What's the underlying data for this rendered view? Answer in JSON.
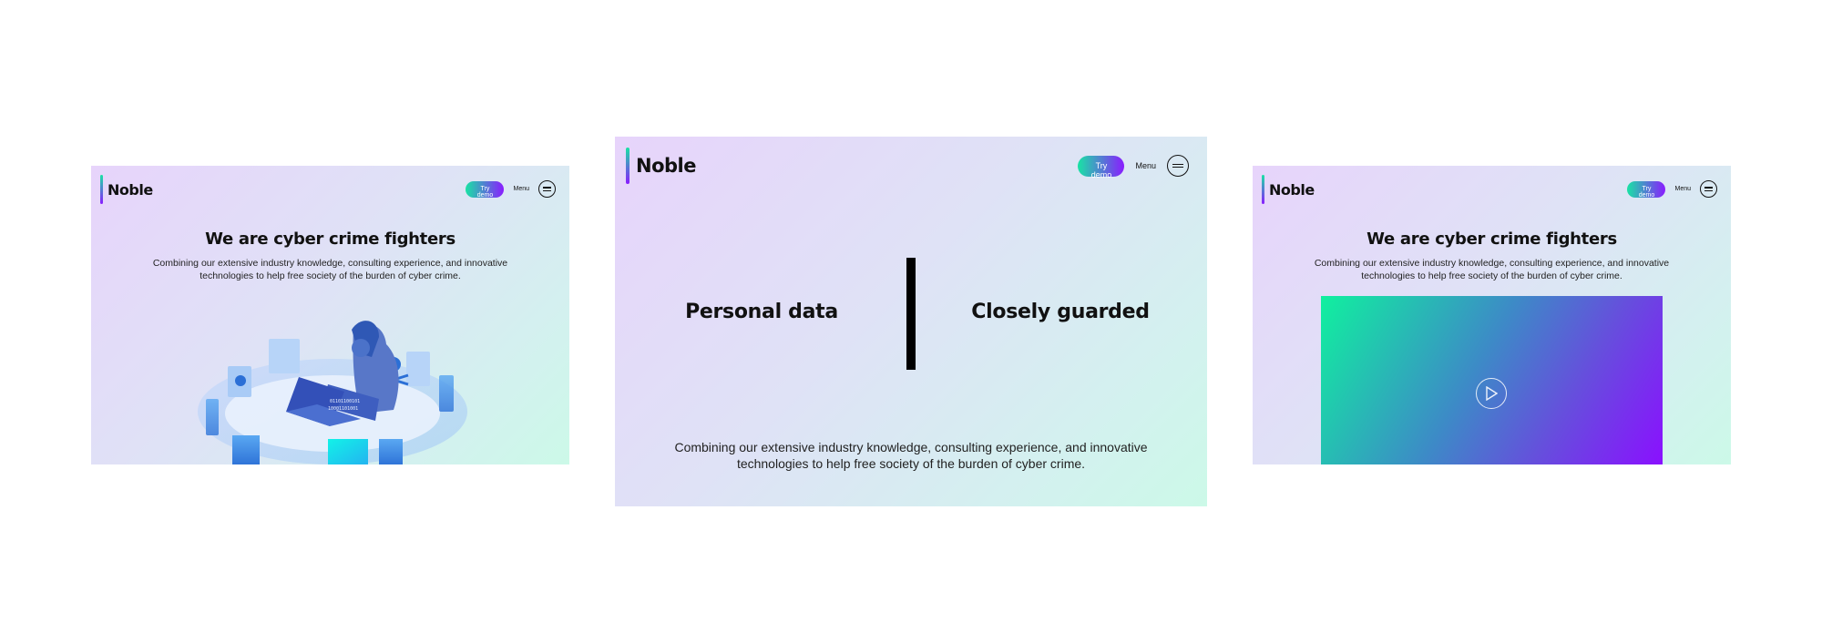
{
  "screens": [
    {
      "logo": "Noble",
      "nav": {
        "demo_label": "Try demo",
        "menu_label": "Menu"
      },
      "title": "We are cyber crime fighters",
      "subtitle": "Combining our extensive industry knowledge, consulting experience, and innovative technologies to help free society of the burden of cyber crime.",
      "media": "hacker-illustration"
    },
    {
      "logo": "Noble",
      "nav": {
        "demo_label": "Try demo",
        "menu_label": "Menu"
      },
      "split": {
        "left": "Personal data",
        "right": "Closely guarded"
      },
      "subtitle": "Combining our extensive industry knowledge, consulting experience, and innovative technologies to help free society of the burden of cyber crime."
    },
    {
      "logo": "Noble",
      "nav": {
        "demo_label": "Try demo",
        "menu_label": "Menu"
      },
      "title": "We are cyber crime fighters",
      "subtitle": "Combining our extensive industry knowledge, consulting experience, and innovative technologies to help free society of the burden of cyber crime.",
      "media": "video-player"
    }
  ],
  "colors": {
    "accent_green": "#19e3a4",
    "accent_purple": "#8a1cff",
    "text": "#111111"
  },
  "icons": [
    "menu-icon",
    "play-icon"
  ]
}
